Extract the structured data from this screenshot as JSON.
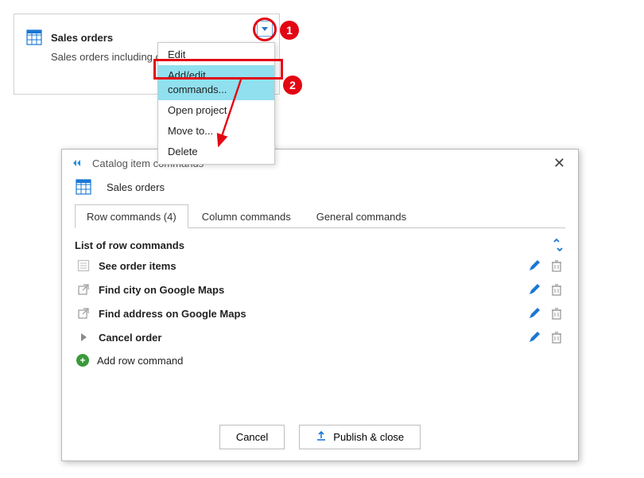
{
  "catalog": {
    "title": "Sales orders",
    "subtitle": "Sales orders including o"
  },
  "menu": {
    "items": [
      "Edit",
      "Add/edit commands...",
      "Open project",
      "Move to...",
      "Delete"
    ]
  },
  "callouts": {
    "n1": "1",
    "n2": "2"
  },
  "dialog": {
    "title": "Catalog item commands",
    "catalog_name": "Sales orders",
    "tabs": {
      "row": "Row commands (4)",
      "column": "Column commands",
      "general": "General commands"
    },
    "list_header": "List of row commands",
    "rows": [
      "See order items",
      "Find city on Google Maps",
      "Find address on Google Maps",
      "Cancel order"
    ],
    "add_row": "Add row command",
    "buttons": {
      "cancel": "Cancel",
      "publish": "Publish & close"
    }
  }
}
